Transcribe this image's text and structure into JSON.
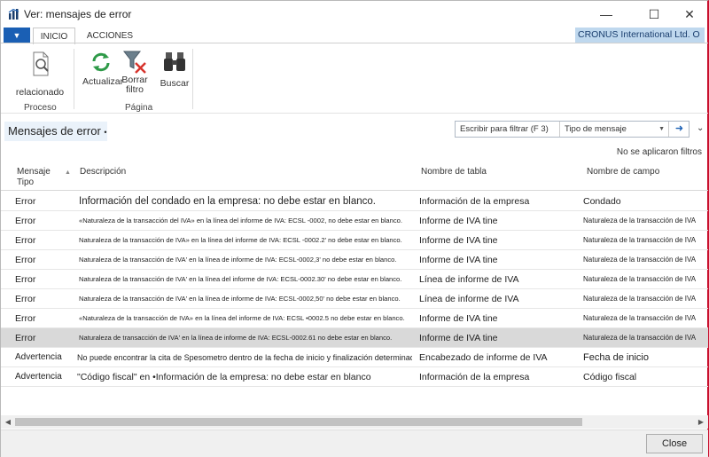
{
  "window": {
    "title": "Ver: mensajes de error",
    "minimize": "—",
    "maximize": "☐",
    "close": "✕"
  },
  "ribbon": {
    "file_glyph": "▼",
    "tabs": [
      "INICIO",
      "ACCIONES"
    ],
    "company": "CRONUS International Ltd. O",
    "related_label": "relacionado",
    "group_proceso": "Proceso",
    "refresh_label": "Actualizar",
    "clear_filter_label": "Borrar filtro",
    "find_label": "Buscar",
    "group_pagina": "Página"
  },
  "page": {
    "title": "Mensajes de error",
    "title_marker": "•",
    "filter_placeholder": "Escribir para filtrar (F 3)",
    "filter_field": "Tipo de mensaje",
    "no_filters": "No se aplicaron filtros"
  },
  "grid": {
    "columns": {
      "type": "Mensaje Tipo",
      "description": "Descripción",
      "table": "Nombre de tabla",
      "field": "Nombre de campo"
    },
    "rows": [
      {
        "type": "Error",
        "description": "Información del condado en la empresa: no debe estar en blanco.",
        "table": "Información de la empresa",
        "field": "Condado"
      },
      {
        "type": "Error",
        "description": "«Naturaleza de la transacción del IVA» en la línea del informe de IVA: ECSL -0002, no debe estar en blanco.",
        "table": "Informe de IVA tine",
        "field": "Naturaleza de la transacción de IVA"
      },
      {
        "type": "Error",
        "description": "Naturaleza de la transacción de IVA» en la línea del informe de IVA: ECSL -0002.2' no debe estar en blanco.",
        "table": "Informe de IVA tine",
        "field": "Naturaleza de la transacción de IVA"
      },
      {
        "type": "Error",
        "description": "Naturaleza de la transacción de IVA' en la línea de informe de IVA: ECSL-0002,3' no debe estar en blanco.",
        "table": "Informe de IVA tine",
        "field": "Naturaleza de la transacción de IVA"
      },
      {
        "type": "Error",
        "description": "Naturaleza de la transacción de IVA' en la línea del informe de IVA: ECSL-0002.30' no debe estar en blanco.",
        "table": "Línea de informe de IVA",
        "field": "Naturaleza de la transacción de IVA"
      },
      {
        "type": "Error",
        "description": "Naturaleza de la transacción de IVA' en la línea de informe de IVA: ECSL-0002,50' no debe estar en blanco.",
        "table": "Línea de informe de IVA",
        "field": "Naturaleza de la transacción de IVA"
      },
      {
        "type": "Error",
        "description": "«Naturaleza de la transacción de IVA» en la línea del informe de IVA: ECSL •0002.5 no debe estar en blanco.",
        "table": "Informe de IVA tine",
        "field": "Naturaleza de la transacción de IVA"
      },
      {
        "type": "Error",
        "description": "Naturaleza de transacción de IVA' en la línea de informe de IVA: ECSL-0002.61 no debe estar en blanco.",
        "table": "Informe de IVA tine",
        "field": "Naturaleza de la transacción de IVA"
      },
      {
        "type": "Advertencia",
        "description": "No puede encontrar la cita de Spesometro dentro de la fecha de inicio y finalización determinada.",
        "table": "Encabezado de informe de IVA",
        "field": "Fecha de inicio"
      },
      {
        "type": "Advertencia",
        "description": "\"Código fiscal\" en •Información de la empresa: no debe estar en blanco",
        "table": "Información de la empresa",
        "field": "Código fiscal"
      }
    ]
  },
  "scrollbar": {
    "left": "◀",
    "right": "▶"
  },
  "footer": {
    "close_label": "Close"
  },
  "colors": {
    "accent": "#1a5fb4",
    "company_bg": "#bfd8ee",
    "selected_row": "#d9d9d9"
  }
}
